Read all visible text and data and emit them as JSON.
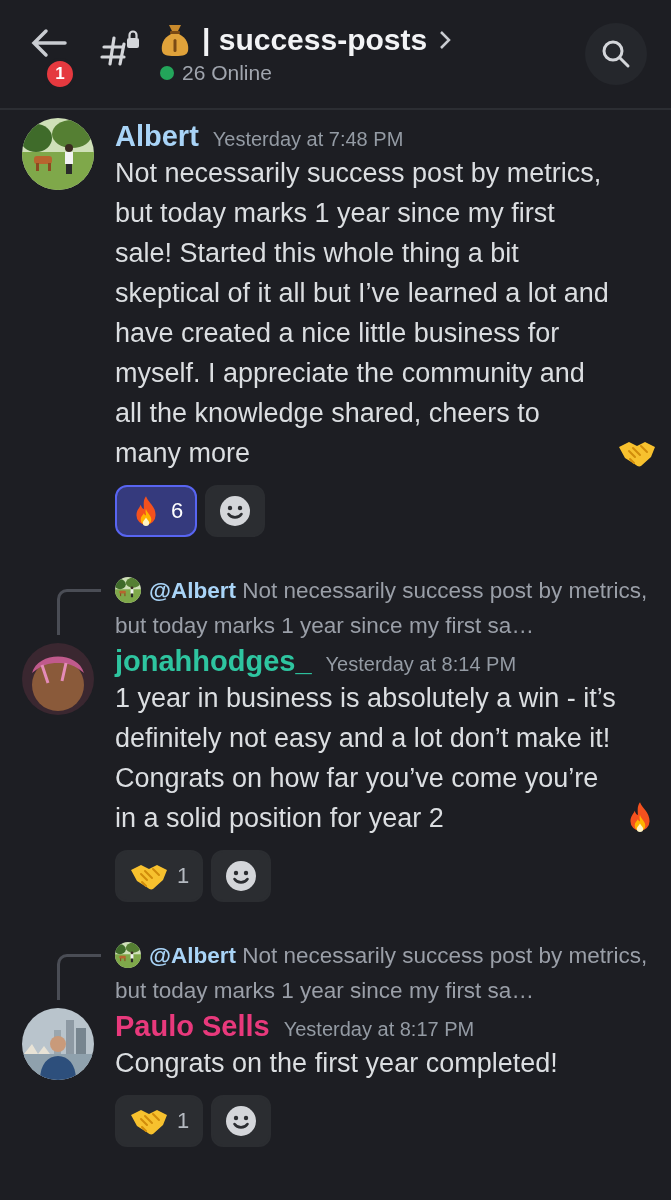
{
  "header": {
    "back_badge": "1",
    "channel_name": "| success-posts",
    "online": "26 Online"
  },
  "messages": [
    {
      "author": "Albert",
      "color": "#a9d4f7",
      "time": "Yesterday at 7:48 PM",
      "text": "Not necessarily success post by metrics, but today marks 1 year since my first sale! Started this whole thing a bit skeptical of it all but I’ve learned a lot and have created a nice little business for myself. I appreciate the community and all the knowledge shared, cheers to many more",
      "end_icon": {
        "kind": "handshake"
      },
      "reactions": [
        {
          "kind": "fire",
          "count": "6",
          "selected": true
        }
      ]
    },
    {
      "reply": {
        "mention": "@Albert",
        "preview": "Not necessarily success post by metrics, but today marks 1 year since my first sa…"
      },
      "author": "jonahhodges_",
      "color": "#2ec5a0",
      "avatar": {
        "kind": "avatar"
      },
      "time": "Yesterday at 8:14 PM",
      "text": "1 year in business is absolutely a win - it’s definitely not easy and a lot don’t make it! Congrats on how far you’ve come you’re in a solid position for year 2",
      "end_icon": {
        "kind": "fire"
      },
      "reactions": [
        {
          "kind": "handshake",
          "count": "1",
          "selected": false
        }
      ]
    },
    {
      "reply": {
        "mention": "@Albert",
        "preview": "Not necessarily success post by metrics, but today marks 1 year since my first sa…"
      },
      "author": "Paulo Sells",
      "color": "#e8397c",
      "time": "Yesterday at 8:17 PM",
      "text": "Congrats on the first year completed!",
      "reactions": [
        {
          "kind": "handshake",
          "count": "1",
          "selected": false
        }
      ]
    }
  ]
}
